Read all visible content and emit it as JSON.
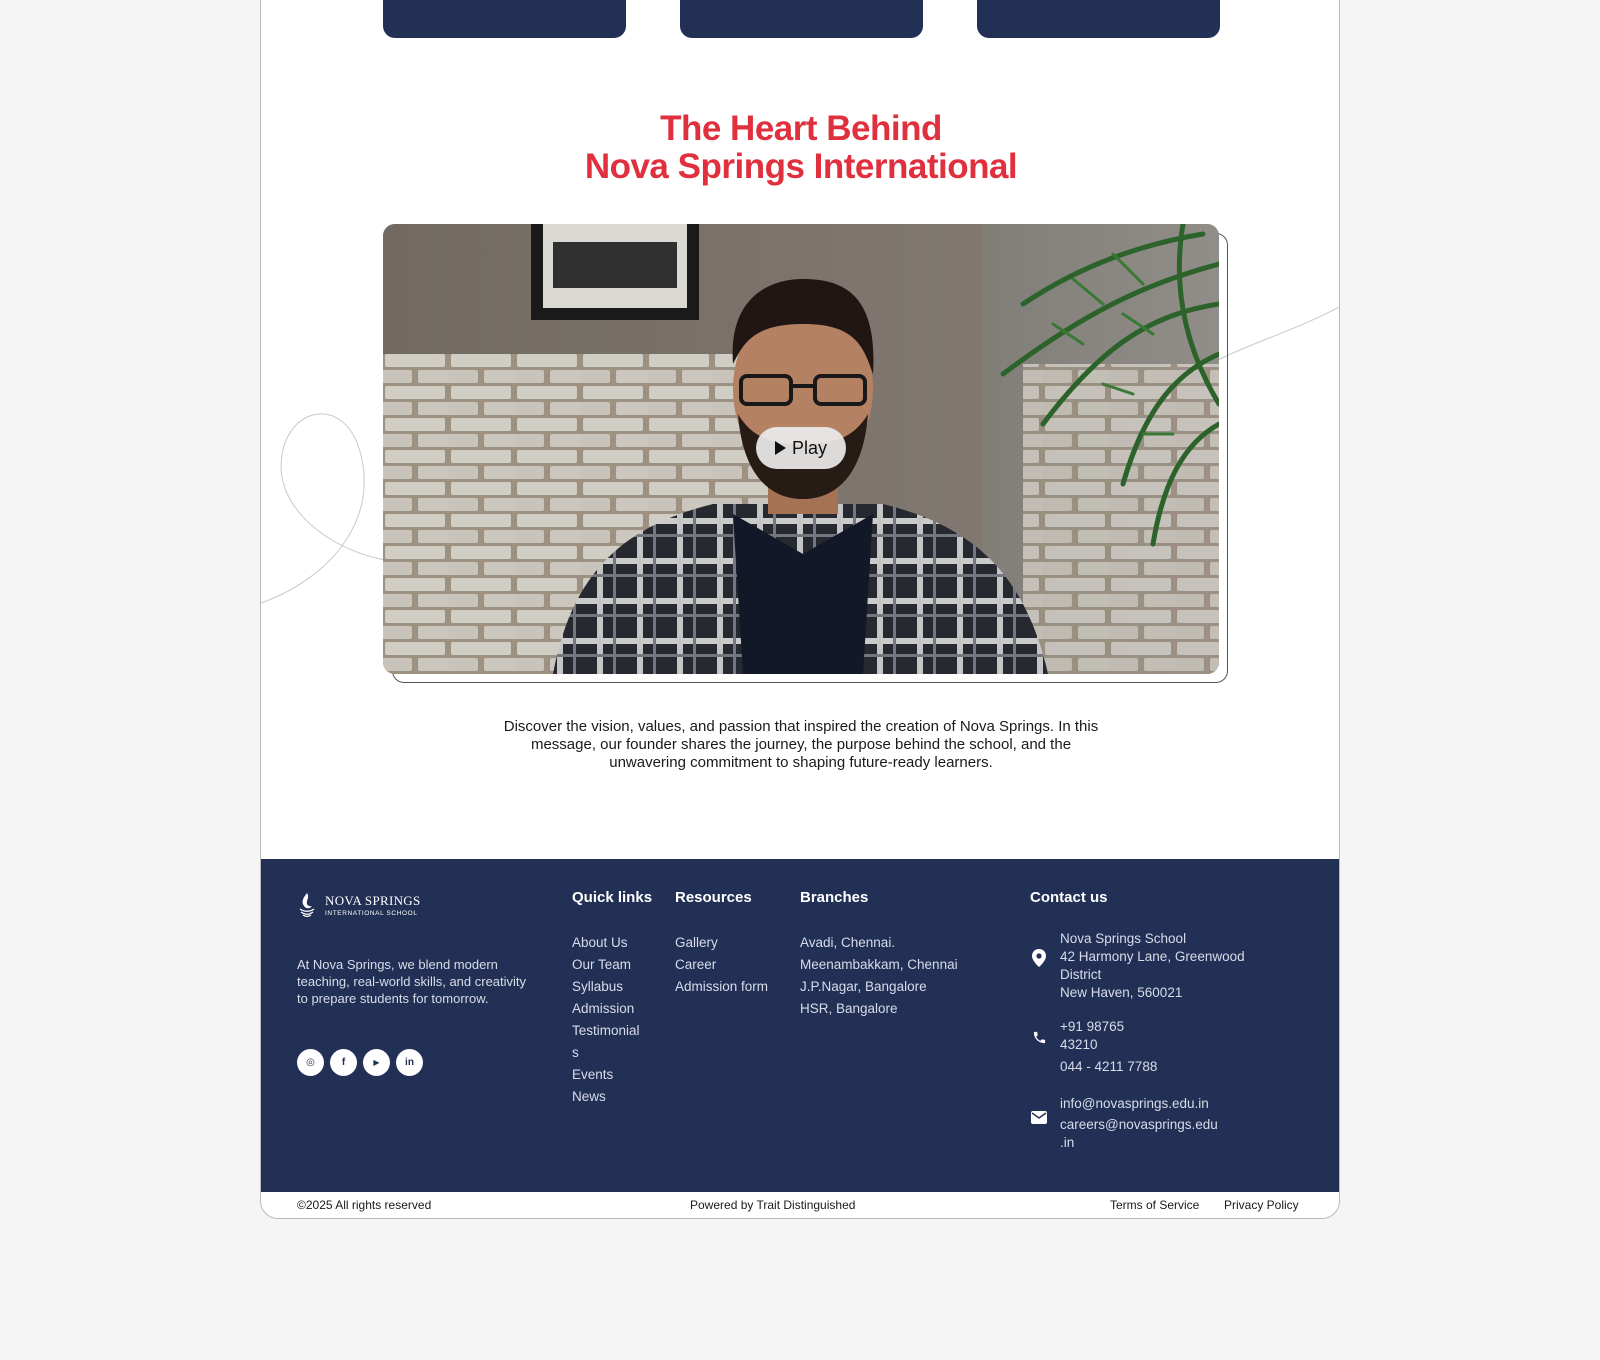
{
  "heading": {
    "line1": "The Heart Behind",
    "line2": "Nova Springs International"
  },
  "video": {
    "play_label": "Play",
    "description": "Discover the vision, values, and passion that inspired the creation of Nova Springs. In this message, our founder shares the journey, the purpose behind the school, and the unwavering commitment to shaping future-ready learners."
  },
  "footer": {
    "logo": {
      "title": "NOVA SPRINGS",
      "subtitle": "INTERNATIONAL SCHOOL"
    },
    "about": "At Nova Springs, we blend modern teaching, real-world skills, and creativity to prepare students for tomorrow.",
    "social": [
      {
        "icon": "instagram-icon",
        "glyph": "◎"
      },
      {
        "icon": "facebook-icon",
        "glyph": "f"
      },
      {
        "icon": "youtube-icon",
        "glyph": "▶"
      },
      {
        "icon": "linkedin-icon",
        "glyph": "in"
      }
    ],
    "quick_links": {
      "title": "Quick links",
      "items": [
        "About Us",
        "Our Team",
        "Syllabus",
        "Admission",
        "Testimonial",
        "s",
        "Events",
        "News"
      ]
    },
    "resources": {
      "title": "Resources",
      "items": [
        "Gallery",
        "Career",
        "Admission form"
      ]
    },
    "branches": {
      "title": "Branches",
      "items": [
        "Avadi, Chennai.",
        "Meenambakkam, Chennai",
        "J.P.Nagar, Bangalore",
        "HSR, Bangalore"
      ]
    },
    "contact": {
      "title": "Contact us",
      "address": [
        "Nova Springs School",
        "42 Harmony Lane, Greenwood",
        "District",
        "New Haven, 560021"
      ],
      "phone": [
        "+91 98765",
        "43210",
        "044 - 4211 7788"
      ],
      "email": [
        "info@novasprings.edu.in",
        "careers@novasprings.edu",
        ".in"
      ]
    }
  },
  "bottom": {
    "copyright": "©2025 All rights reserved",
    "powered": "Powered by Trait Distinguished",
    "terms": "Terms of Service",
    "privacy": "Privacy Policy"
  },
  "colors": {
    "accent_red": "#e0303d",
    "navy": "#213054",
    "page_bg": "#f5f5f5"
  }
}
